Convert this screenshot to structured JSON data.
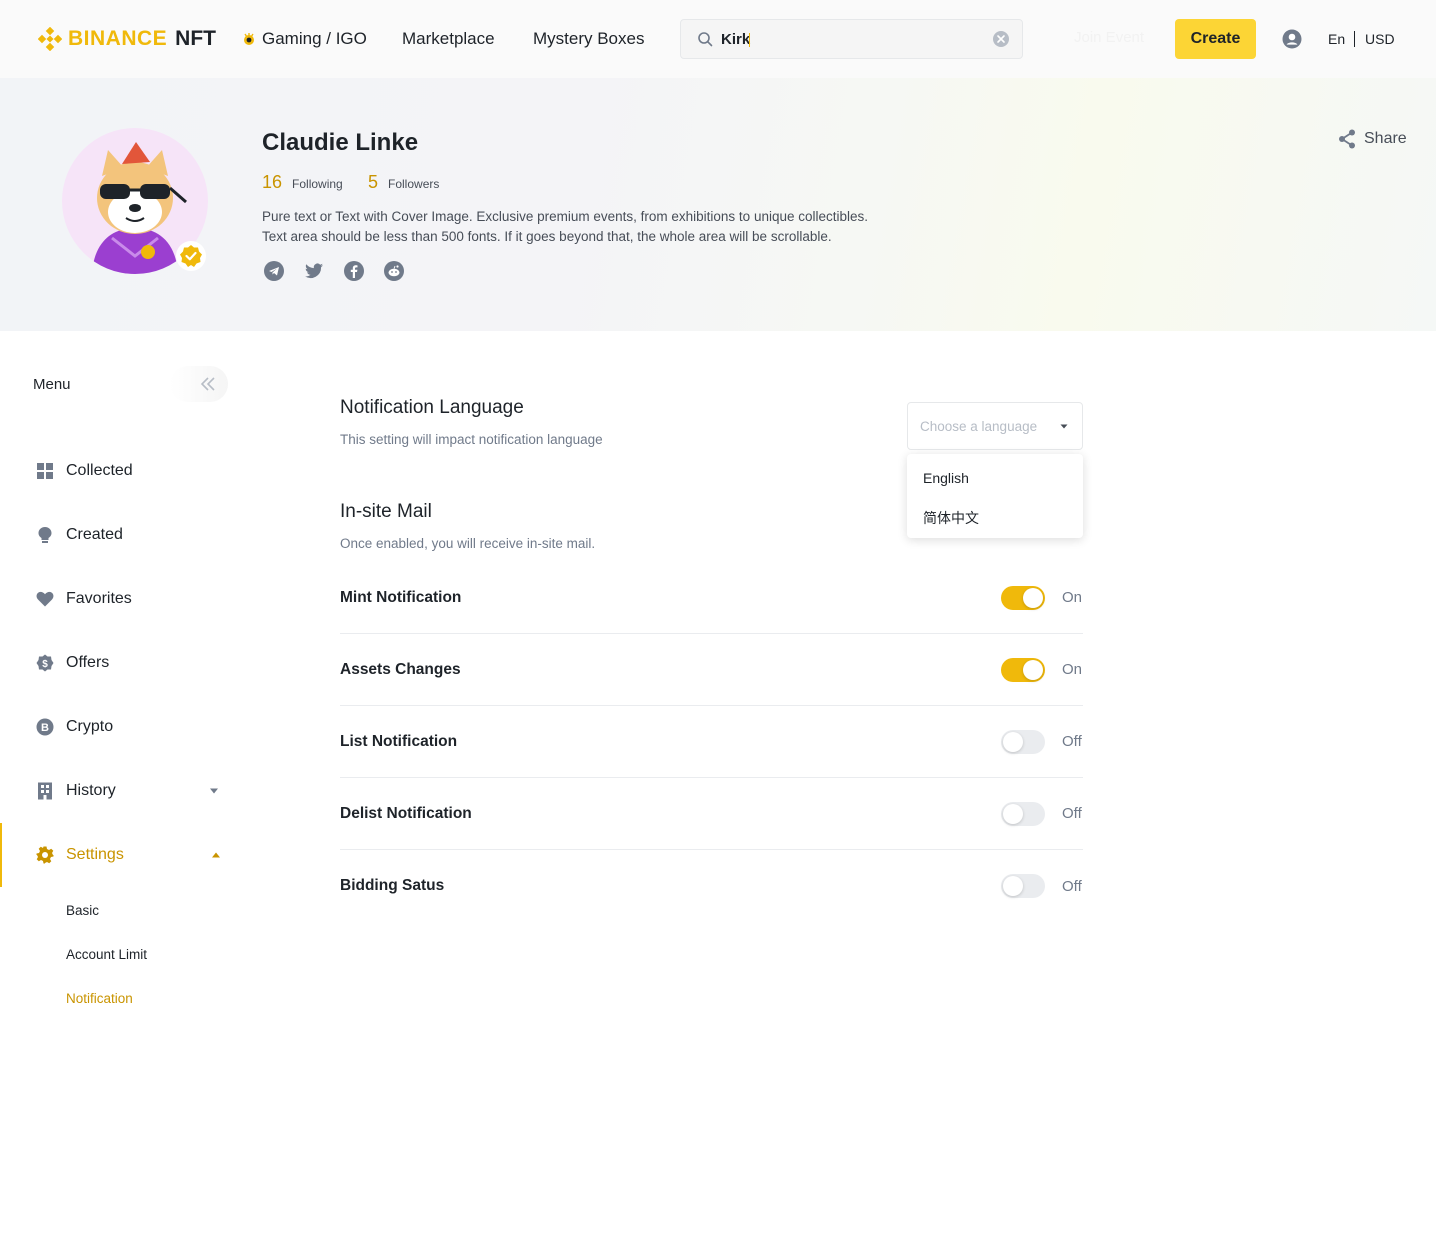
{
  "header": {
    "logo_text": "BINANCE",
    "logo_suffix": "NFT",
    "nav": [
      "Gaming / IGO",
      "Marketplace",
      "Mystery Boxes"
    ],
    "search_value": "Kirk",
    "ghost_button": "Join Event",
    "create_label": "Create",
    "language": "En",
    "currency": "USD"
  },
  "profile": {
    "name": "Claudie Linke",
    "following_count": "16",
    "following_label": "Following",
    "followers_count": "5",
    "followers_label": "Followers",
    "bio_line1": "Pure text or Text with Cover Image. Exclusive premium events, from exhibitions to unique collectibles.",
    "bio_line2": "Text area should be less than 500 fonts. If it goes beyond that, the whole area will be scrollable.",
    "socials": [
      "telegram-icon",
      "twitter-icon",
      "facebook-icon",
      "reddit-icon"
    ],
    "share_label": "Share"
  },
  "sidebar": {
    "title": "Menu",
    "items": [
      {
        "label": "Collected"
      },
      {
        "label": "Created"
      },
      {
        "label": "Favorites"
      },
      {
        "label": "Offers"
      },
      {
        "label": "Crypto"
      },
      {
        "label": "History"
      },
      {
        "label": "Settings"
      }
    ],
    "sub_items": [
      "Basic",
      "Account Limit",
      "Notification"
    ]
  },
  "main": {
    "language_section": {
      "title": "Notification Language",
      "description": "This setting will impact notification language",
      "placeholder": "Choose a language",
      "options": [
        "English",
        "简体中文"
      ]
    },
    "mail_section": {
      "title": "In-site Mail",
      "description": "Once enabled, you will receive in-site mail."
    },
    "toggles": [
      {
        "label": "Mint Notification",
        "state": "On",
        "on": true
      },
      {
        "label": "Assets Changes",
        "state": "On",
        "on": true
      },
      {
        "label": "List Notification",
        "state": "Off",
        "on": false
      },
      {
        "label": "Delist Notification",
        "state": "Off",
        "on": false
      },
      {
        "label": "Bidding Satus",
        "state": "Off",
        "on": false
      }
    ]
  },
  "colors": {
    "brand_yellow": "#f0b90b",
    "button_yellow": "#fcd535",
    "active_text": "#c99400"
  }
}
